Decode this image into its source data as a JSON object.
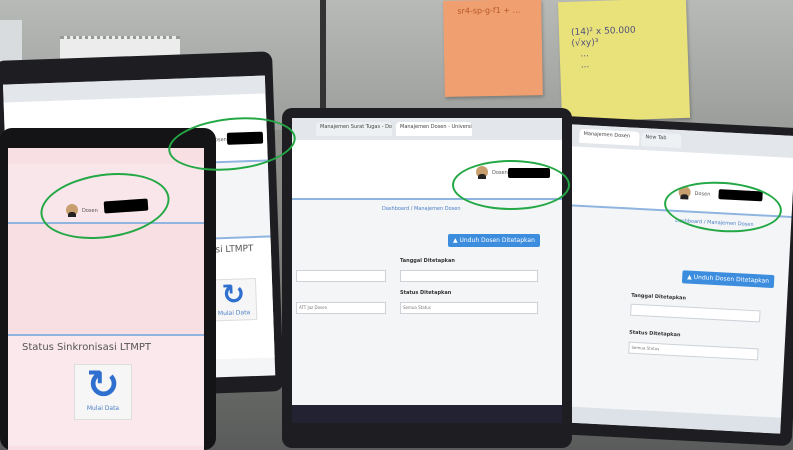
{
  "notes": {
    "orange_text": "sr4-sp-g-f1 + ...",
    "yellow_text": "(14)² x 50.000\n(√xy)³\n   ...\n   ..."
  },
  "laptop_center": {
    "tabs": [
      "Manajemen Surat Tugas - Dosen",
      "Manajemen Dosen - Universitas"
    ],
    "breadcrumb": "Dashboard / Manajemen Dosen",
    "button": "Unduh Dosen Ditetapkan",
    "label_tanggal": "Tanggal Ditetapkan",
    "label_status": "Status Ditetapkan",
    "option_status": "Semua Status",
    "option_left": "ATT Jaz Dosen",
    "user_label": "Dosen"
  },
  "laptop_right": {
    "tabs": [
      "Manajemen Dosen",
      "New Tab"
    ],
    "breadcrumb": "Dashboard / Manajemen Dosen",
    "button": "Unduh Dosen Ditetapkan",
    "label_tanggal": "Tanggal Ditetapkan",
    "label_status": "Status Ditetapkan",
    "option_status": "Semua Status",
    "user_label": "Dosen"
  },
  "tablet_back": {
    "card_title": "Sinkronisasi LTMPT",
    "sync_label": "Mulai Data",
    "user_label": "Dosen"
  },
  "tablet_front": {
    "card_title": "Status Sinkronisasi LTMPT",
    "sync_label": "Mulai Data",
    "user_label": "Dosen"
  },
  "colors": {
    "highlight": "#23a845",
    "accent": "#3c8dde",
    "pink": "#f7dfe3"
  },
  "icons": [
    "sync-icon",
    "user-avatar-icon",
    "download-icon"
  ]
}
